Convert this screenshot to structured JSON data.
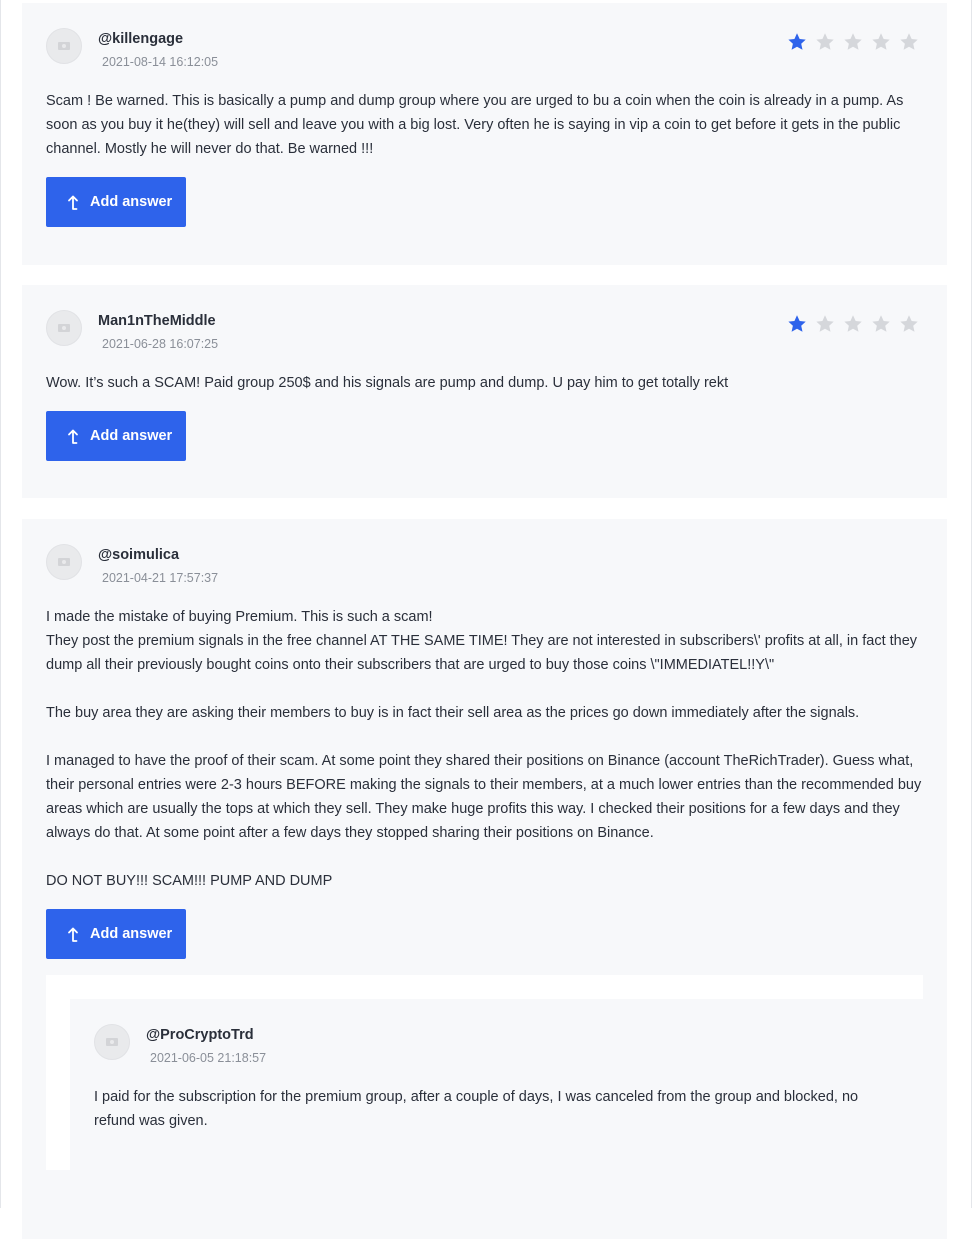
{
  "accent_color": "#2e63eb",
  "star_inactive_color": "#d5d7db",
  "reviews": [
    {
      "username": "@killengage",
      "date": "2021-08-14 16:12:05",
      "rating": 1,
      "rating_max": 5,
      "paragraphs": [
        "Scam ! Be warned. This is basically a pump and dump group where you are urged to bu a coin when the coin is already in a pump. As soon as you buy it he(they) will sell and leave you with a big lost. Very often he is saying in vip a coin to get before it gets in the public channel. Mostly he will never do that. Be warned !!!"
      ],
      "button_label": "Add answer"
    },
    {
      "username": "Man1nTheMiddle",
      "date": "2021-06-28 16:07:25",
      "rating": 1,
      "rating_max": 5,
      "paragraphs": [
        "Wow. It’s such a SCAM! Paid group 250$ and his signals are pump and dump. U pay him to get totally rekt"
      ],
      "button_label": "Add answer"
    },
    {
      "username": "@soimulica",
      "date": "2021-04-21 17:57:37",
      "paragraphs": [
        "I made the mistake of buying Premium. This is such a scam!",
        "They post the premium signals in the free channel AT THE SAME TIME! They are not interested in subscribers\\' profits at all, in fact they dump all their previously bought coins onto their subscribers that are urged to buy those coins \\\"IMMEDIATEL!!Y\\\"",
        "",
        "The buy area they are asking their members to buy is in fact their sell area as the prices go down immediately after the signals.",
        "",
        "I managed to have the proof of their scam. At some point they shared their positions on Binance (account TheRichTrader). Guess what, their personal entries were 2-3 hours BEFORE making the signals to their members, at a much lower entries than the recommended buy areas which are usually the tops at which they sell. They make huge profits this way. I checked their positions for a few days and they always do that. At some point after a few days they stopped sharing their positions on Binance.",
        "",
        "DO NOT BUY!!! SCAM!!! PUMP AND DUMP"
      ],
      "button_label": "Add answer",
      "answers": [
        {
          "username": "@ProCryptoTrd",
          "date": "2021-06-05 21:18:57",
          "text": "I paid for the subscription for the premium group, after a couple of days, I was canceled from the group and blocked, no refund was given."
        }
      ]
    }
  ]
}
